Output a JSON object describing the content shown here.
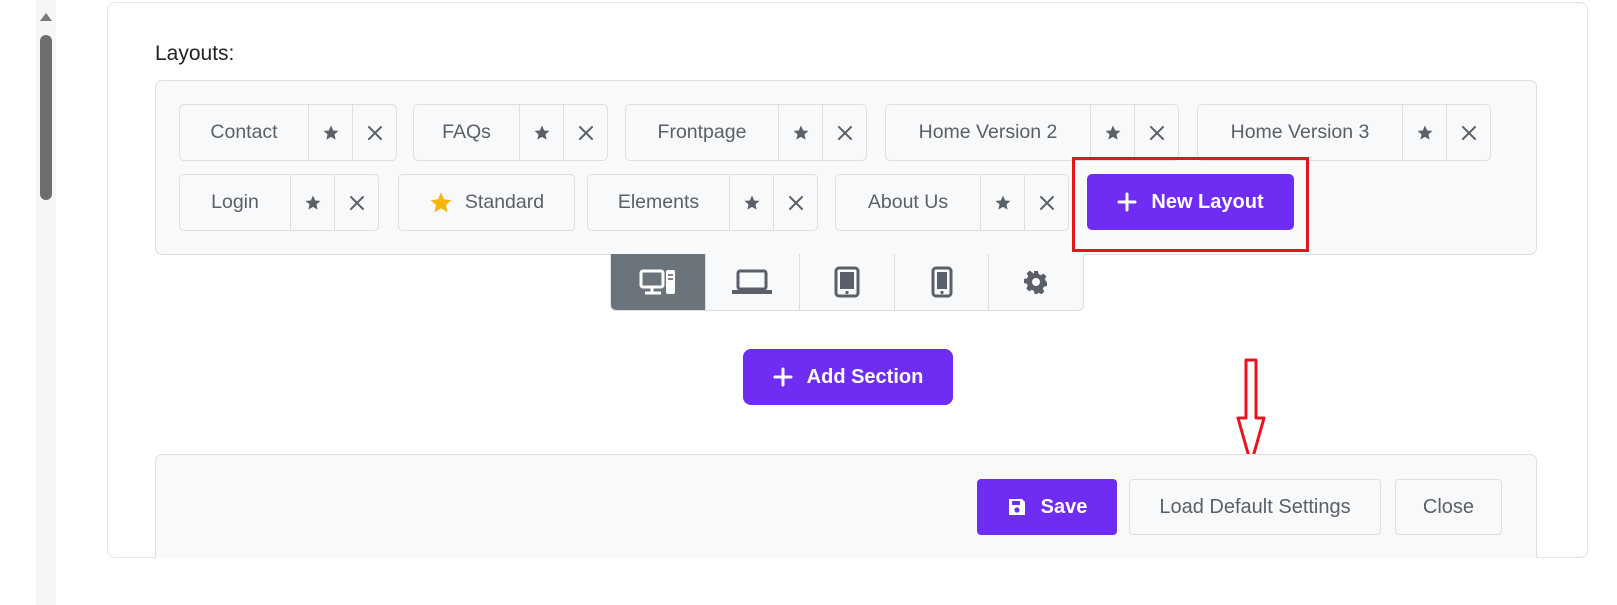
{
  "layouts_label": "Layouts:",
  "layouts": [
    {
      "name": "Contact",
      "is_default": false
    },
    {
      "name": "FAQs",
      "is_default": false
    },
    {
      "name": "Frontpage",
      "is_default": false
    },
    {
      "name": "Home Version 2",
      "is_default": false
    },
    {
      "name": "Home Version 3",
      "is_default": false
    },
    {
      "name": "Login",
      "is_default": false
    },
    {
      "name": "Standard",
      "is_default": true
    },
    {
      "name": "Elements",
      "is_default": false
    },
    {
      "name": "About Us",
      "is_default": false
    }
  ],
  "new_layout_label": "New Layout",
  "devices": [
    "desktop-icon",
    "laptop-icon",
    "tablet-icon",
    "mobile-icon",
    "gear-icon"
  ],
  "add_section_label": "Add Section",
  "footer": {
    "save_label": "Save",
    "load_default_label": "Load Default Settings",
    "close_label": "Close"
  },
  "colors": {
    "accent": "#6f2cf3",
    "annotation": "#e5141e",
    "default_star": "#f5b50a",
    "active_device": "#6b737b"
  }
}
